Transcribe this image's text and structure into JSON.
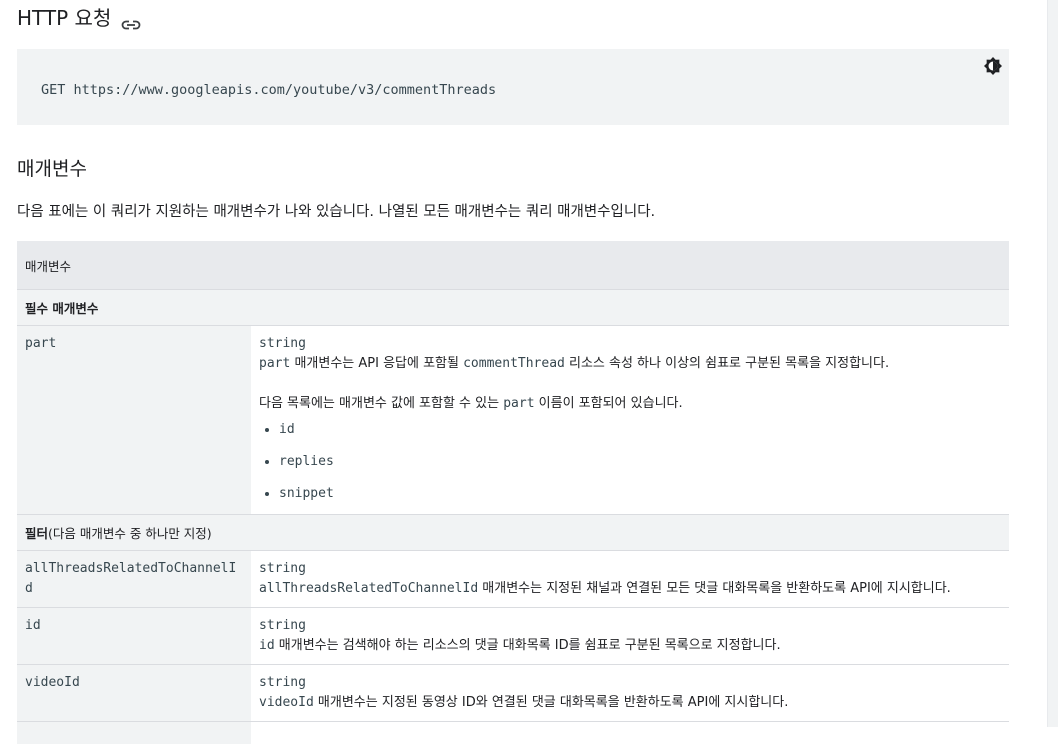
{
  "http_request": {
    "heading": "HTTP 요청",
    "link_icon": "link-icon",
    "method_url": "GET https://www.googleapis.com/youtube/v3/commentThreads",
    "theme_toggle_icon": "brightness-icon"
  },
  "parameters": {
    "heading": "매개변수",
    "intro": "다음 표에는 이 쿼리가 지원하는 매개변수가 나와 있습니다. 나열된 모든 매개변수는 쿼리 매개변수입니다.",
    "table_header": "매개변수",
    "required_section": "필수 매개변수",
    "part": {
      "name": "part",
      "type": "string",
      "desc_code": "part",
      "desc_mid": " 매개변수는 API 응답에 포함될 ",
      "desc_code2": "commentThread",
      "desc_end": " 리소스 속성 하나 이상의 쉼표로 구분된 목록을 지정합니다.",
      "list_intro_start": "다음 목록에는 매개변수 값에 포함할 수 있는 ",
      "list_intro_code": "part",
      "list_intro_end": " 이름이 포함되어 있습니다.",
      "values": [
        "id",
        "replies",
        "snippet"
      ]
    },
    "filter_section_bold": "필터",
    "filter_section_rest": "(다음 매개변수 중 하나만 지정)",
    "filters": [
      {
        "name": "allThreadsRelatedToChannelId",
        "type": "string",
        "desc_code": "allThreadsRelatedToChannelId",
        "desc_text": " 매개변수는 지정된 채널과 연결된 모든 댓글 대화목록을 반환하도록 API에 지시합니다."
      },
      {
        "name": "id",
        "type": "string",
        "desc_code": "id",
        "desc_text": " 매개변수는 검색해야 하는 리소스의 댓글 대화목록 ID를 쉼표로 구분된 목록으로 지정합니다."
      },
      {
        "name": "videoId",
        "type": "string",
        "desc_code": "videoId",
        "desc_text": " 매개변수는 지정된 동영상 ID와 연결된 댓글 대화목록을 반환하도록 API에 지시합니다."
      }
    ]
  }
}
